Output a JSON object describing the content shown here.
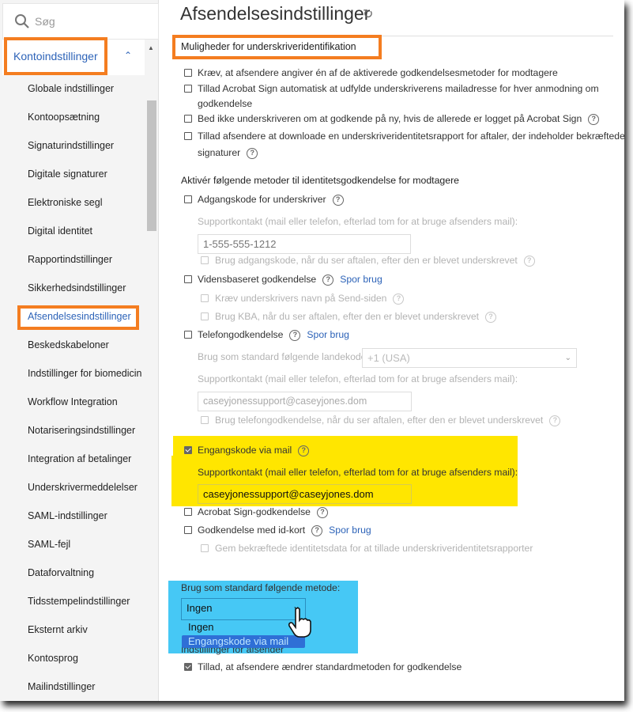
{
  "sidebar": {
    "search_placeholder": "Søg",
    "section": "Kontoindstillinger",
    "items": [
      "Globale indstillinger",
      "Kontoopsætning",
      "Signaturindstillinger",
      "Digitale signaturer",
      "Elektroniske segl",
      "Digital identitet",
      "Rapportindstillinger",
      "Sikkerhedsindstillinger",
      "Afsendelsesindstillinger",
      "Beskedskabeloner",
      "Indstillinger for biomedicin",
      "Workflow Integration",
      "Notariseringsindstillinger",
      "Integration af betalinger",
      "Underskrivermeddelelser",
      "SAML-indstillinger",
      "SAML-fejl",
      "Dataforvaltning",
      "Tidsstempelindstillinger",
      "Eksternt arkiv",
      "Kontosprog",
      "Mailindstillinger"
    ],
    "selected_index": 8
  },
  "main": {
    "title": "Afsendelsesindstillinger",
    "section1": "Muligheder for underskriveridentifikation",
    "opt1": "Kræv, at afsendere angiver én af de aktiverede godkendelsesmetoder for modtagere",
    "opt2a": "Tillad Acrobat Sign automatisk at udfylde underskriverens mailadresse for hver anmodning om",
    "opt2b": "godkendelse",
    "opt3": "Bed ikke underskriveren om at godkende på ny, hvis de allerede er logget på Acrobat Sign",
    "opt4a": "Tillad afsendere at downloade en underskriveridentitetsrapport for aftaler, der indeholder bekræftede",
    "opt4b": "signaturer",
    "section2": "Aktivér følgende metoder til identitetsgodkendelse for modtagere",
    "help": "?",
    "track": "Spor brug",
    "pwd": {
      "label": "Adgangskode for underskriver",
      "support_label": "Supportkontakt (mail eller telefon, efterlad tom for at bruge afsenders mail):",
      "placeholder": "1-555-555-1212",
      "sub": "Brug adgangskode, når du ser aftalen, efter den er blevet underskrevet"
    },
    "kba": {
      "label": "Vidensbaseret godkendelse",
      "sub1": "Kræv underskrivers navn på Send-siden",
      "sub2": "Brug KBA, når du ser aftalen, efter den er blevet underskrevet"
    },
    "phone": {
      "label": "Telefongodkendelse",
      "country_label": "Brug som standard følgende landekode:",
      "country_value": "+1 (USA)",
      "support_label": "Supportkontakt (mail eller telefon, efterlad tom for at bruge afsenders mail):",
      "support_value": "caseyjonessupport@caseyjones.dom",
      "sub": "Brug telefongodkendelse, når du ser aftalen, efter den er blevet underskrevet"
    },
    "otp": {
      "label": "Engangskode via mail",
      "checked": true,
      "support_label": "Supportkontakt (mail eller telefon, efterlad tom for at bruge afsenders mail):",
      "support_value": "caseyjonessupport@caseyjones.dom"
    },
    "acrobat": {
      "label": "Acrobat Sign-godkendelse"
    },
    "idcard": {
      "label": "Godkendelse med id-kort",
      "sub": "Gem bekræftede identitetsdata for at tillade underskriveridentitetsrapporter"
    },
    "default_method": {
      "label": "Brug som standard følgende metode:",
      "value": "Ingen",
      "options": [
        "Ingen",
        "Engangskode via mail"
      ],
      "highlighted": "Engangskode via mail"
    },
    "sender_section": "Indstillinger for afsender",
    "sender_opt": "Tillad, at afsendere ændrer standardmetoden for godkendelse",
    "sender_checked": true
  },
  "colors": {
    "highlight_orange": "#f47d20",
    "highlight_yellow": "#ffe600",
    "highlight_blue": "#46c8f5",
    "link": "#2d63b8"
  }
}
